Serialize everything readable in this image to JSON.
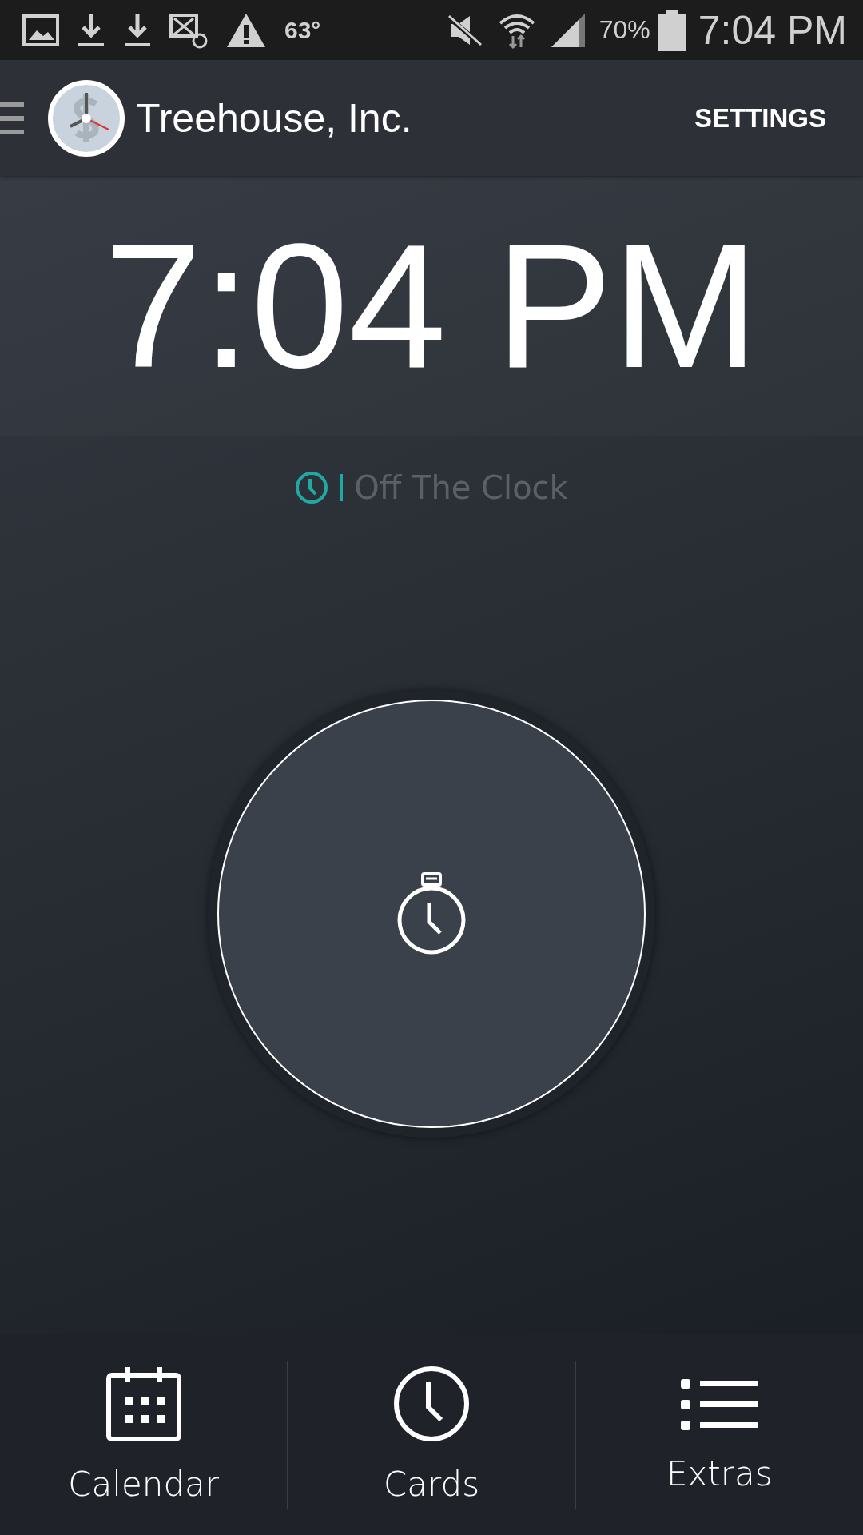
{
  "status_bar": {
    "temperature": "63°",
    "battery": "70%",
    "time": "7:04 PM"
  },
  "app_bar": {
    "title": "Treehouse, Inc.",
    "action": "SETTINGS"
  },
  "clock": {
    "time": "7:04 PM"
  },
  "status": {
    "label": "Off The Clock"
  },
  "bottom_nav": [
    {
      "kind": "calendar",
      "label": "Calendar"
    },
    {
      "kind": "clock",
      "label": "Cards"
    },
    {
      "kind": "list",
      "label": "Extras"
    }
  ]
}
